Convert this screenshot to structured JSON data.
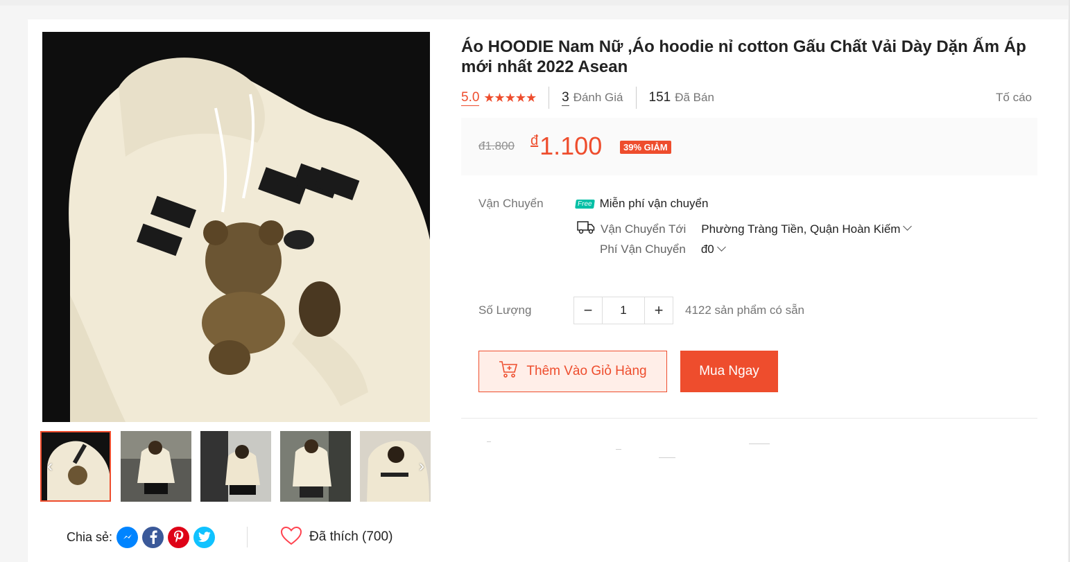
{
  "product": {
    "title": "Áo HOODIE Nam Nữ ,Áo hoodie nỉ cotton Gấu Chất Vải Dày Dặn Ấm Áp mới nhất 2022 Asean",
    "rating": "5.0",
    "stars": "★★★★★",
    "review_count": "3",
    "review_label": "Đánh Giá",
    "sold_count": "151",
    "sold_label": "Đã Bán",
    "report_label": "Tố cáo"
  },
  "price": {
    "old": "đ1.800",
    "currency": "đ",
    "current": "1.100",
    "discount": "39% GIẢM"
  },
  "shipping": {
    "label": "Vận Chuyển",
    "free_badge": "Free",
    "free_text": "Miễn phí vận chuyển",
    "to_label": "Vận Chuyển Tới",
    "to_value": "Phường Tràng Tiền, Quận Hoàn Kiếm",
    "fee_label": "Phí Vận Chuyển",
    "fee_value": "đ0"
  },
  "quantity": {
    "label": "Số Lượng",
    "value": "1",
    "minus": "−",
    "plus": "+",
    "stock": "4122 sản phẩm có sẵn"
  },
  "actions": {
    "add_to_cart": "Thêm Vào Giỏ Hàng",
    "buy_now": "Mua Ngay"
  },
  "share": {
    "label": "Chia sẻ:",
    "networks": [
      "messenger-icon",
      "facebook-icon",
      "pinterest-icon",
      "twitter-icon"
    ]
  },
  "like": {
    "label": "Đã thích (700)"
  },
  "colors": {
    "accent": "#ee4d2d",
    "free_badge": "#00bfa5"
  }
}
